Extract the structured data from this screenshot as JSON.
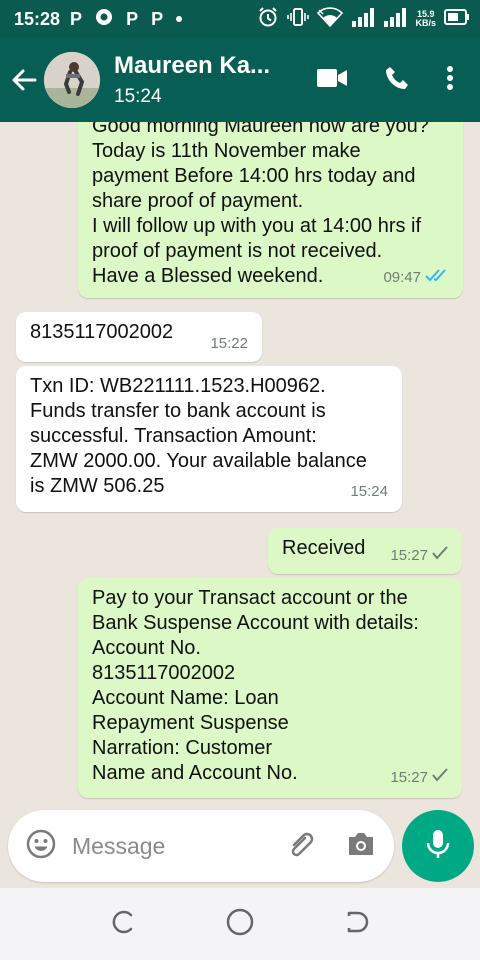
{
  "status_bar": {
    "time": "15:28",
    "notification_icons": [
      "P",
      "P",
      "P"
    ],
    "speed_value": "15.9",
    "speed_unit": "KB/s"
  },
  "header": {
    "contact_name": "Maureen Ka...",
    "last_seen": "15:24"
  },
  "messages": [
    {
      "direction": "outgoing",
      "text": "Good morning Maureen how are you?\nToday is 11th November make\npayment Before 14:00 hrs today and\nshare proof of payment.\nI will follow up with you at 14:00 hrs if\nproof of payment is not received.\nHave a Blessed weekend.",
      "time": "09:47",
      "status": "read"
    },
    {
      "direction": "incoming",
      "text": "8135117002002",
      "time": "15:22"
    },
    {
      "direction": "incoming",
      "text": "Txn ID: WB221111.1523.H00962.\nFunds transfer to bank account is\nsuccessful. Transaction Amount:\nZMW 2000.00. Your available balance\nis ZMW 506.25",
      "time": "15:24"
    },
    {
      "direction": "outgoing",
      "text": "Received",
      "time": "15:27",
      "status": "sent"
    },
    {
      "direction": "outgoing",
      "text": "Pay to your Transact account or the\nBank Suspense Account with details:\nAccount No.\n8135117002002\nAccount Name:              Loan\nRepayment Suspense\nNarration:                   Customer\nName and Account No.",
      "time": "15:27",
      "status": "sent"
    }
  ],
  "composer": {
    "placeholder": "Message"
  },
  "colors": {
    "header": "#075e54",
    "status_bar": "#0b5a50",
    "accent": "#00a884",
    "outgoing_bubble": "#dcf8c6",
    "read_tick": "#34b7f1"
  }
}
